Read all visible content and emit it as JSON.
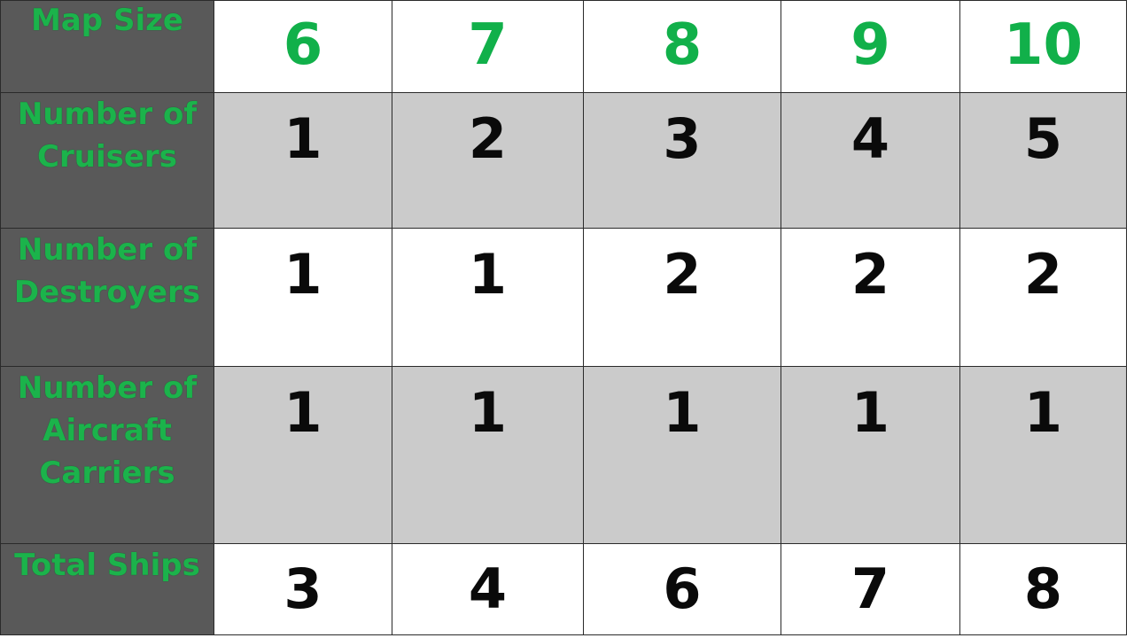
{
  "table": {
    "header_label": "Map Size",
    "map_sizes": [
      "6",
      "7",
      "8",
      "9",
      "10"
    ],
    "rows": [
      {
        "label_lines": [
          "Number of",
          "Cruisers"
        ],
        "values": [
          "1",
          "2",
          "3",
          "4",
          "5"
        ]
      },
      {
        "label_lines": [
          "Number of",
          "Destroyers"
        ],
        "values": [
          "1",
          "1",
          "2",
          "2",
          "2"
        ]
      },
      {
        "label_lines": [
          "Number of",
          "Aircraft",
          "Carriers"
        ],
        "values": [
          "1",
          "1",
          "1",
          "1",
          "1"
        ]
      },
      {
        "label_lines": [
          "Total Ships"
        ],
        "values": [
          "3",
          "4",
          "6",
          "7",
          "8"
        ]
      }
    ]
  },
  "colors": {
    "label_green": "#1bb34b",
    "header_number_green": "#11b04a",
    "label_background": "#595959",
    "shaded_row": "#cbcbcb"
  }
}
